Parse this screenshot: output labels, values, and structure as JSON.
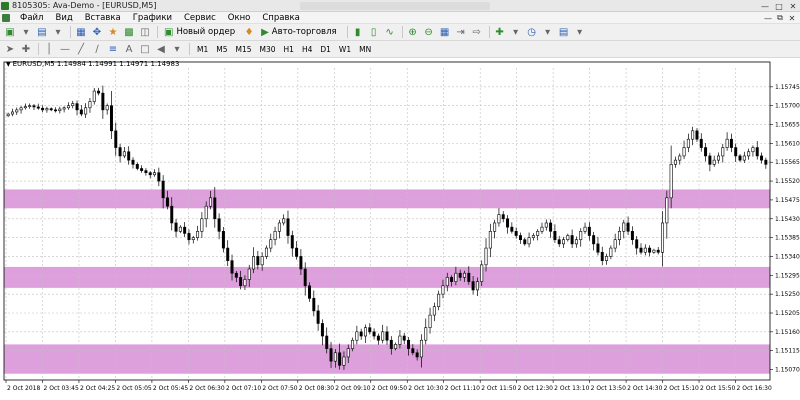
{
  "window": {
    "title": "8105305: Ava-Demo - [EURUSD,M5]",
    "minimize_icon": "minimize-icon",
    "maximize_icon": "maximize-icon",
    "close_icon": "close-icon"
  },
  "menu": {
    "items": [
      "Файл",
      "Вид",
      "Вставка",
      "Графики",
      "Сервис",
      "Окно",
      "Справка"
    ]
  },
  "toolbar": {
    "new_order_label": "Новый ордер",
    "auto_trading_label": "Авто-торговля",
    "timeframes": [
      "M1",
      "M5",
      "M15",
      "M30",
      "H1",
      "H4",
      "D1",
      "W1",
      "MN"
    ]
  },
  "chart": {
    "header": "EURUSD,M5  1.14984 1.14991 1.14971 1.14983"
  },
  "colors": {
    "zone": "#dda0dd",
    "candle": "#000000",
    "grid": "#c0c0c0"
  },
  "chart_data": {
    "type": "candlestick",
    "symbol": "EURUSD",
    "timeframe": "M5",
    "ylim": [
      1.15045,
      1.1579
    ],
    "y_ticks": [
      1.15745,
      1.157,
      1.15655,
      1.1561,
      1.15565,
      1.1552,
      1.15475,
      1.1543,
      1.15385,
      1.1534,
      1.15295,
      1.1525,
      1.15205,
      1.1516,
      1.15115,
      1.1507
    ],
    "x_ticks": [
      "2 Oct 2018",
      "2 Oct 03:45",
      "2 Oct 04:25",
      "2 Oct 05:05",
      "2 Oct 05:45",
      "2 Oct 06:30",
      "2 Oct 07:10",
      "2 Oct 07:50",
      "2 Oct 08:30",
      "2 Oct 09:10",
      "2 Oct 09:50",
      "2 Oct 10:30",
      "2 Oct 11:10",
      "2 Oct 11:50",
      "2 Oct 12:30",
      "2 Oct 13:10",
      "2 Oct 13:50",
      "2 Oct 14:30",
      "2 Oct 15:10",
      "2 Oct 15:50",
      "2 Oct 16:30"
    ],
    "zones": [
      {
        "from": 1.15455,
        "to": 1.155
      },
      {
        "from": 1.15265,
        "to": 1.15315
      },
      {
        "from": 1.1506,
        "to": 1.1513
      }
    ],
    "series": [
      {
        "values": [
          1.1568,
          1.15685,
          1.1569,
          1.15695,
          1.15698,
          1.157,
          1.15697,
          1.15694,
          1.1569,
          1.15693,
          1.1569,
          1.15688,
          1.15692,
          1.15695,
          1.157,
          1.15705,
          1.1569,
          1.1568,
          1.15695,
          1.1571,
          1.15735,
          1.1573,
          1.1569,
          1.157,
          1.1564,
          1.156,
          1.1558,
          1.1559,
          1.1557,
          1.1556,
          1.1555,
          1.15545,
          1.1554,
          1.15535,
          1.1554,
          1.1552,
          1.1548,
          1.1546,
          1.1542,
          1.154,
          1.1541,
          1.15395,
          1.1538,
          1.15385,
          1.154,
          1.1543,
          1.1546,
          1.1548,
          1.1543,
          1.154,
          1.1536,
          1.1533,
          1.153,
          1.1529,
          1.1527,
          1.15285,
          1.1531,
          1.1534,
          1.1532,
          1.1534,
          1.1536,
          1.1538,
          1.154,
          1.1542,
          1.1543,
          1.1539,
          1.1536,
          1.1534,
          1.1531,
          1.1527,
          1.1524,
          1.1521,
          1.1518,
          1.1515,
          1.1512,
          1.1509,
          1.1511,
          1.1508,
          1.151,
          1.1512,
          1.1514,
          1.1516,
          1.1515,
          1.1517,
          1.1516,
          1.1515,
          1.1514,
          1.1516,
          1.1514,
          1.1512,
          1.1513,
          1.1515,
          1.1514,
          1.1512,
          1.1511,
          1.151,
          1.1514,
          1.1517,
          1.152,
          1.1522,
          1.1525,
          1.1527,
          1.1529,
          1.1528,
          1.153,
          1.1529,
          1.153,
          1.1528,
          1.1526,
          1.1528,
          1.1532,
          1.1536,
          1.154,
          1.1542,
          1.1544,
          1.1543,
          1.1541,
          1.154,
          1.1539,
          1.1538,
          1.1537,
          1.15385,
          1.1539,
          1.154,
          1.1541,
          1.1542,
          1.154,
          1.1538,
          1.1537,
          1.1538,
          1.1539,
          1.1537,
          1.1538,
          1.154,
          1.1541,
          1.1539,
          1.1537,
          1.1535,
          1.1533,
          1.1534,
          1.1536,
          1.1538,
          1.154,
          1.1542,
          1.154,
          1.1538,
          1.1536,
          1.1535,
          1.1536,
          1.1535,
          1.15355,
          1.1535,
          1.1542,
          1.1548,
          1.1556,
          1.1557,
          1.1558,
          1.156,
          1.1562,
          1.1564,
          1.1562,
          1.156,
          1.1558,
          1.1556,
          1.1557,
          1.1558,
          1.156,
          1.1562,
          1.156,
          1.1558,
          1.1557,
          1.1558,
          1.1559,
          1.156,
          1.1558,
          1.1557,
          1.1556
        ]
      }
    ]
  }
}
